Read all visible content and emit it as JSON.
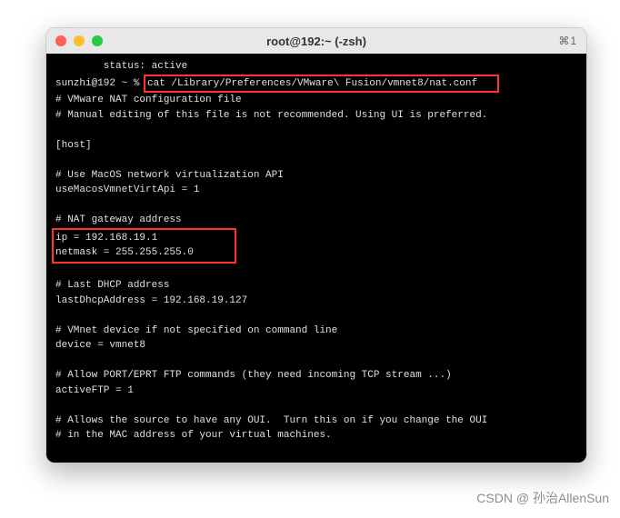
{
  "window": {
    "title": "root@192:~ (-zsh)",
    "shortcut": "⌘1"
  },
  "terminal": {
    "status_line": "        status: active",
    "prompt": "sunzhi@192 ~ % ",
    "command": "cat /Library/Preferences/VMware\\ Fusion/vmnet8/nat.conf",
    "comment1": "# VMware NAT configuration file",
    "comment2": "# Manual editing of this file is not recommended. Using UI is preferred.",
    "section_host": "[host]",
    "comment3": "# Use MacOS network virtualization API",
    "line_virtapi": "useMacosVmnetVirtApi = 1",
    "comment4": "# NAT gateway address",
    "line_ip": "ip = 192.168.19.1",
    "line_netmask": "netmask = 255.255.255.0",
    "comment5": "# Last DHCP address",
    "line_lastdhcp": "lastDhcpAddress = 192.168.19.127",
    "comment6": "# VMnet device if not specified on command line",
    "line_device": "device = vmnet8",
    "comment7": "# Allow PORT/EPRT FTP commands (they need incoming TCP stream ...)",
    "line_activeftp": "activeFTP = 1",
    "comment8": "# Allows the source to have any OUI.  Turn this on if you change the OUI",
    "comment9": "# in the MAC address of your virtual machines."
  },
  "watermark": "CSDN @ 孙治AllenSun"
}
